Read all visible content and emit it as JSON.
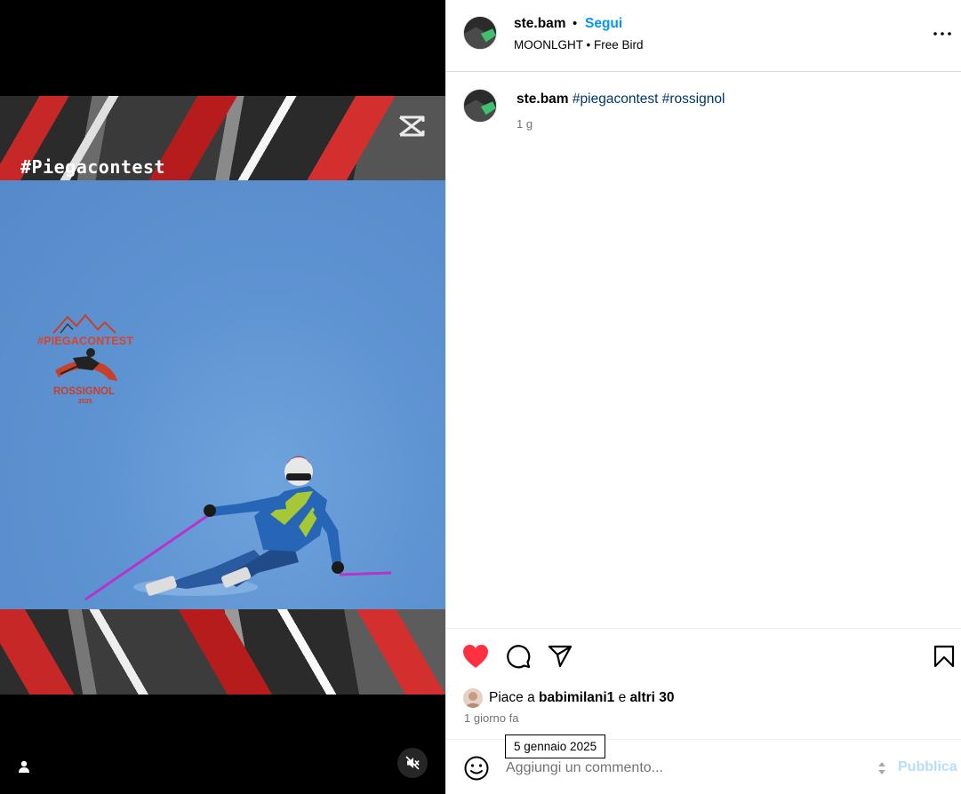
{
  "media": {
    "overlay_hashtag": "#Piegacontest",
    "logo": {
      "line1": "#PIEGACONTEST",
      "line2": "ROSSIGNOL",
      "line3": "2025"
    },
    "icons": {
      "capcut": "capcut-logo-icon",
      "user_tag": "person-icon",
      "mute": "speaker-muted-icon"
    }
  },
  "header": {
    "username": "ste.bam",
    "separator": "•",
    "follow_label": "Segui",
    "audio": "MOONLGHT • Free Bird",
    "more_label": "..."
  },
  "caption": {
    "username": "ste.bam",
    "tags": "#piegacontest #rossignol",
    "time": "1 g"
  },
  "actions": {
    "icons": [
      "heart-filled-icon",
      "comment-icon",
      "share-icon",
      "bookmark-icon"
    ],
    "like_color": "#ff3040"
  },
  "likes": {
    "prefix": "Piace a",
    "user": "babimilani1",
    "connector": "e",
    "others": "altri 30"
  },
  "time_ago": "1 giorno fa",
  "tooltip": "5 gennaio 2025",
  "comment": {
    "placeholder": "Aggiungi un commento...",
    "publish_label": "Pubblica",
    "publish_color": "#b2dffc"
  }
}
